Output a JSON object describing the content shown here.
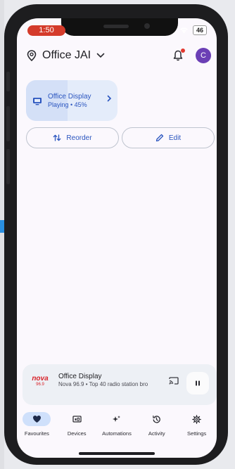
{
  "status_bar": {
    "time": "1:50",
    "battery": "46"
  },
  "header": {
    "home_name": "Office JAI",
    "avatar_initial": "C"
  },
  "device_card": {
    "name": "Office Display",
    "status": "Playing • 45%",
    "volume_percent": 45
  },
  "actions": {
    "reorder_label": "Reorder",
    "edit_label": "Edit"
  },
  "mini_player": {
    "logo_text": "nova",
    "logo_sub": "96.9",
    "title": "Office Display",
    "subtitle": "Nova 96.9 • Top 40 radio station bro"
  },
  "nav": {
    "items": [
      {
        "label": "Favourites",
        "icon": "heart-icon",
        "active": true
      },
      {
        "label": "Devices",
        "icon": "devices-icon",
        "active": false
      },
      {
        "label": "Automations",
        "icon": "sparkle-icon",
        "active": false
      },
      {
        "label": "Activity",
        "icon": "history-icon",
        "active": false
      },
      {
        "label": "Settings",
        "icon": "gear-icon",
        "active": false
      }
    ]
  },
  "colors": {
    "accent": "#2a55bf",
    "card": "#e4ecfa",
    "avatar": "#6b3fb5",
    "time_pill": "#d43b2b"
  }
}
